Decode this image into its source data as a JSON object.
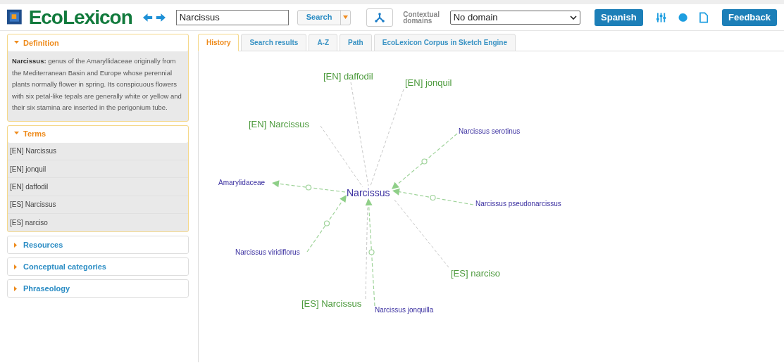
{
  "header": {
    "logo": "EcoLexicon",
    "search": {
      "value": "Narcissus"
    },
    "search_button": "Search",
    "domains_label": "Contextual domains",
    "domain_select": "No domain",
    "language_button": "Spanish",
    "feedback_button": "Feedback"
  },
  "sidebar": [
    {
      "title": "Definition",
      "expanded": true,
      "kind": "definition",
      "text": "**Narcissus:** genus of the Amaryllidaceae originally from the Mediterranean Basin and Europe whose perennial plants normally flower in spring. Its conspicuous flowers with six petal-like tepals are generally white or yellow and their six stamina are inserted in the perigonium tube."
    },
    {
      "title": "Terms",
      "expanded": true,
      "kind": "list",
      "items": [
        "[EN] Narcissus",
        "[EN] jonquil",
        "[EN] daffodil",
        "[ES] Narcissus",
        "[ES] narciso"
      ]
    },
    {
      "title": "Resources",
      "expanded": false
    },
    {
      "title": "Conceptual categories",
      "expanded": false
    },
    {
      "title": "Phraseology",
      "expanded": false
    }
  ],
  "tabs": [
    {
      "label": "History",
      "selected": true
    },
    {
      "label": "Search results",
      "selected": false
    },
    {
      "label": "A-Z",
      "selected": false
    },
    {
      "label": "Path",
      "selected": false
    },
    {
      "label": "EcoLexicon Corpus in Sketch Engine",
      "selected": false
    }
  ],
  "graph": {
    "center": "Narcissus",
    "nodes": [
      {
        "label": "[EN] daffodil",
        "kind": "term"
      },
      {
        "label": "[EN] jonquil",
        "kind": "term"
      },
      {
        "label": "[EN] Narcissus",
        "kind": "term"
      },
      {
        "label": "Narcissus serotinus",
        "kind": "concept"
      },
      {
        "label": "Amarylidaceae",
        "kind": "concept"
      },
      {
        "label": "Narcissus pseudonarcissus",
        "kind": "concept"
      },
      {
        "label": "Narcissus viridiflorus",
        "kind": "concept"
      },
      {
        "label": "[ES] narciso",
        "kind": "term"
      },
      {
        "label": "[ES] Narcissus",
        "kind": "term"
      },
      {
        "label": "Narcissus jonquilla",
        "kind": "concept"
      }
    ]
  }
}
